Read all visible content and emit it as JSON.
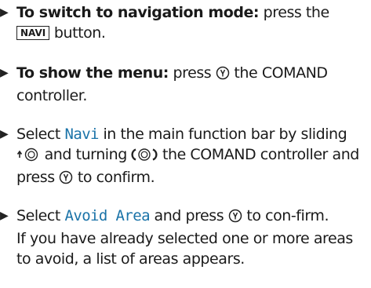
{
  "arrow_glyph": "▶",
  "step1": {
    "bold": "To switch to navigation mode:",
    "text_a": " press the",
    "key": "NAVI",
    "text_b": " button."
  },
  "step2": {
    "bold": "To show the menu:",
    "text_a": " press ",
    "text_b": " the COMAND controller."
  },
  "step3": {
    "text_a": "Select ",
    "menu": "Navi",
    "text_b": " in the main function bar by sliding ",
    "text_c": " and turning ",
    "text_d": " the COMAND controller and press ",
    "text_e": " to confirm."
  },
  "step4": {
    "text_a": "Select ",
    "menu": "Avoid Area",
    "text_b": " and press ",
    "text_c": " to con-firm.",
    "note": "If you have already selected one or more areas to avoid, a list of areas appears."
  },
  "icons": {
    "press": "controller-press-icon",
    "slide_up": "controller-slide-up-icon",
    "turn": "controller-turn-icon"
  }
}
